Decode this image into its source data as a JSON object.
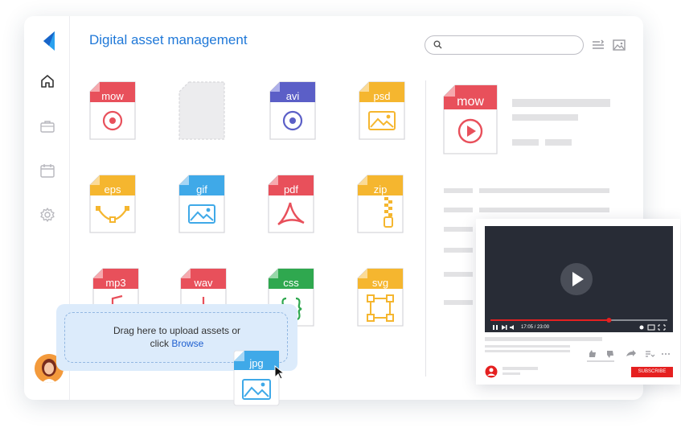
{
  "app": {
    "title": "Digital asset management"
  },
  "search": {
    "placeholder": ""
  },
  "files": [
    {
      "ext": "mow",
      "icon": "video-icon"
    },
    {
      "ext": "",
      "icon": "placeholder"
    },
    {
      "ext": "avi",
      "icon": "video-icon"
    },
    {
      "ext": "psd",
      "icon": "image-icon"
    },
    {
      "ext": "eps",
      "icon": "vector-curve-icon"
    },
    {
      "ext": "gif",
      "icon": "image-icon"
    },
    {
      "ext": "pdf",
      "icon": "pdf-icon"
    },
    {
      "ext": "zip",
      "icon": "zipper-icon"
    },
    {
      "ext": "mp3",
      "icon": "music-icon"
    },
    {
      "ext": "wav",
      "icon": "audio-icon"
    },
    {
      "ext": "css",
      "icon": "code-braces-icon"
    },
    {
      "ext": "svg",
      "icon": "vector-box-icon"
    }
  ],
  "preview": {
    "ext": "mow"
  },
  "upload": {
    "text": "Drag here to upload assets or",
    "click_text": "click",
    "link": "Browse"
  },
  "dragged_file": {
    "ext": "jpg"
  },
  "video": {
    "time": "17:05 / 23:00",
    "progress": 0.67,
    "subscribe": "SUBSCRIBE"
  },
  "colors": {
    "accent": "#1f78d8",
    "red": "#e8505b",
    "purple": "#5b5fc7",
    "orange": "#f5b62f",
    "blue": "#3fa9e8",
    "green": "#2fa84f"
  }
}
